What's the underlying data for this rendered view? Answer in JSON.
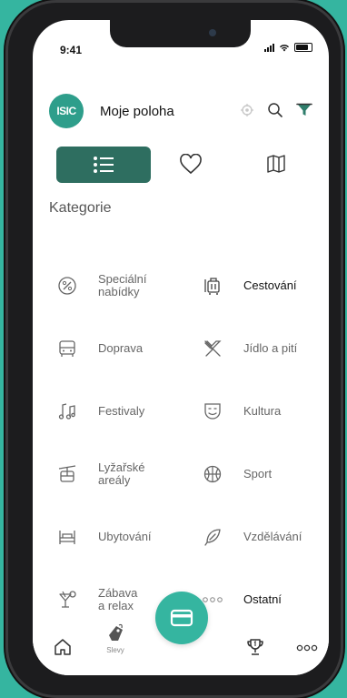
{
  "status": {
    "time": "9:41"
  },
  "header": {
    "logo_text": "ISIC",
    "title": "Moje poloha"
  },
  "section": {
    "title": "Kategorie"
  },
  "categories": [
    {
      "line1": "Speciální",
      "line2": "nabídky",
      "icon": "discount-icon"
    },
    {
      "line1": "Cestování",
      "line2": "",
      "icon": "luggage-icon"
    },
    {
      "line1": "Doprava",
      "line2": "",
      "icon": "bus-icon"
    },
    {
      "line1": "Jídlo a pití",
      "line2": "",
      "icon": "cutlery-icon"
    },
    {
      "line1": "Festivaly",
      "line2": "",
      "icon": "music-icon"
    },
    {
      "line1": "Kultura",
      "line2": "",
      "icon": "theater-icon"
    },
    {
      "line1": "Lyžařské",
      "line2": "areály",
      "icon": "cable-car-icon"
    },
    {
      "line1": "Sport",
      "line2": "",
      "icon": "ball-icon"
    },
    {
      "line1": "Ubytování",
      "line2": "",
      "icon": "bed-icon"
    },
    {
      "line1": "Vzdělávání",
      "line2": "",
      "icon": "feather-icon"
    },
    {
      "line1": "Zábava",
      "line2": "a relax",
      "icon": "cocktail-icon"
    },
    {
      "line1": "Ostatní",
      "line2": "",
      "icon": "dots-icon"
    }
  ],
  "tabbar": {
    "discounts_label": "Slevy"
  },
  "colors": {
    "brand": "#2e9e8b",
    "accent": "#35b5a0",
    "active_view": "#2e6e60"
  }
}
